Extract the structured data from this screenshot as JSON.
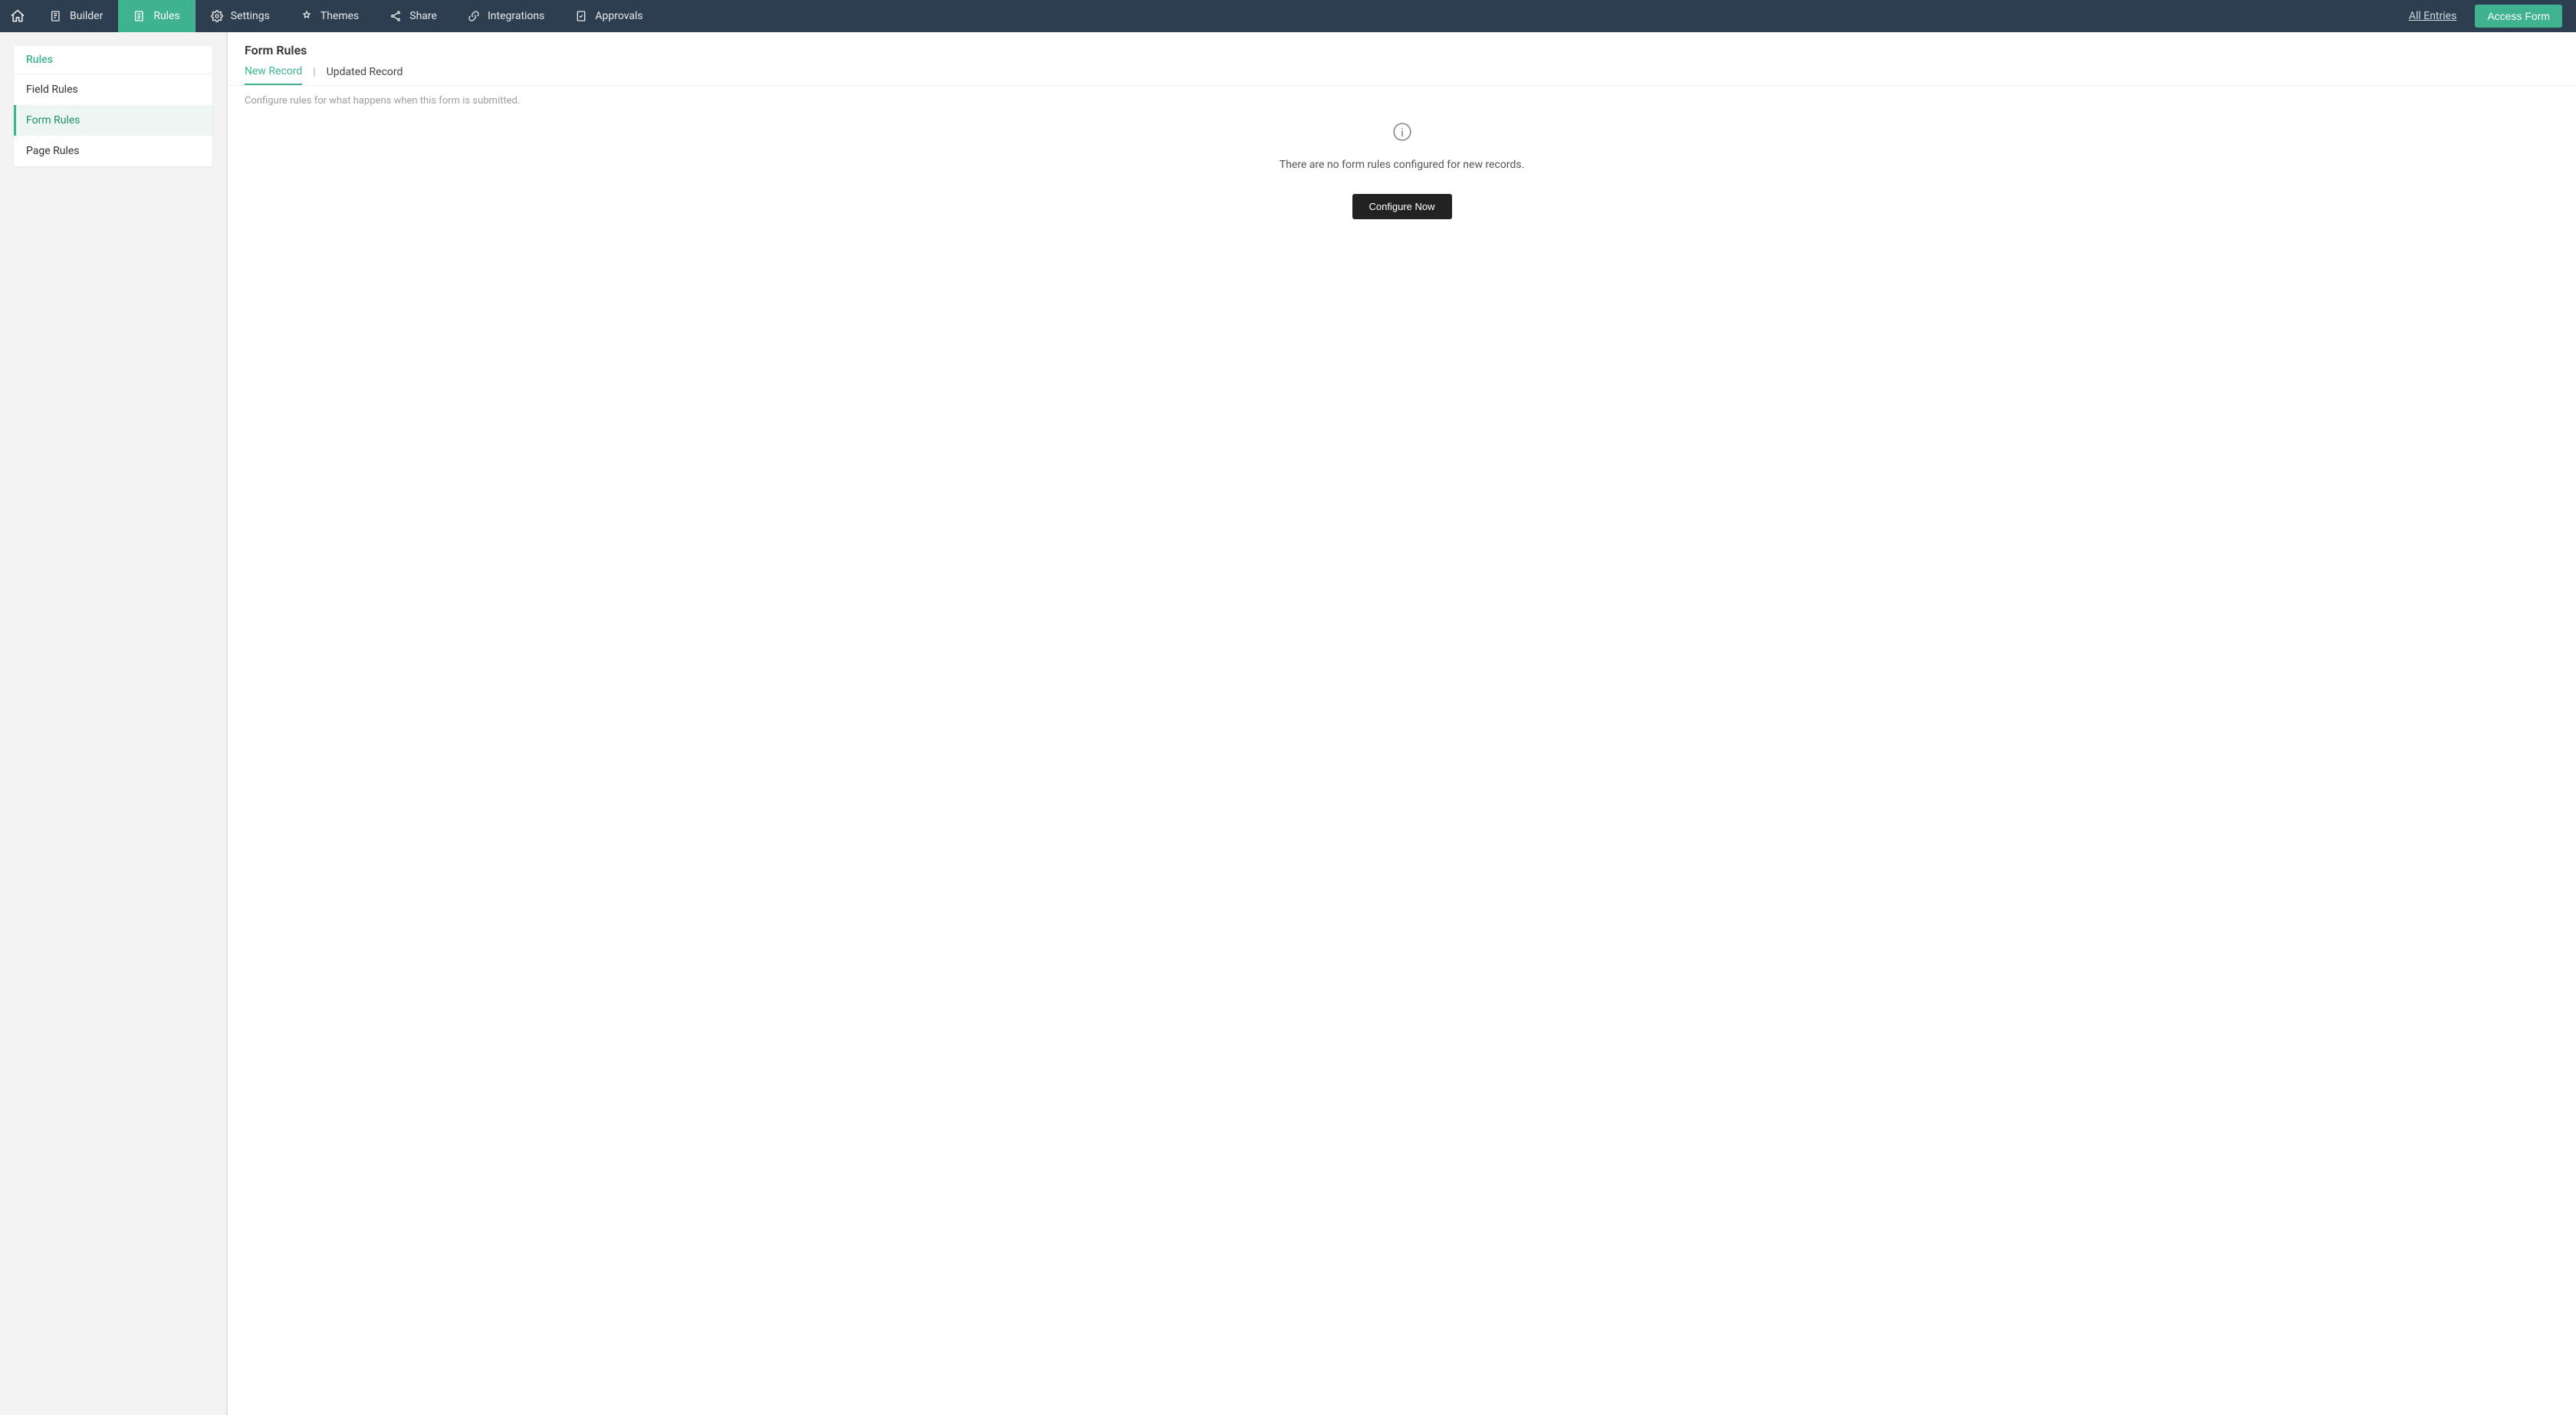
{
  "topbar": {
    "tabs": [
      {
        "label": "Builder"
      },
      {
        "label": "Rules"
      },
      {
        "label": "Settings"
      },
      {
        "label": "Themes"
      },
      {
        "label": "Share"
      },
      {
        "label": "Integrations"
      },
      {
        "label": "Approvals"
      }
    ],
    "all_entries": "All Entries",
    "access_form": "Access Form"
  },
  "sidebar": {
    "heading": "Rules",
    "items": [
      {
        "label": "Field Rules"
      },
      {
        "label": "Form Rules"
      },
      {
        "label": "Page Rules"
      }
    ]
  },
  "main": {
    "title": "Form Rules",
    "sub_tabs": {
      "new_record": "New Record",
      "updated_record": "Updated Record"
    },
    "description": "Configure rules for what happens when this form is submitted.",
    "empty_message": "There are no form rules configured for new records.",
    "configure_button": "Configure Now"
  }
}
